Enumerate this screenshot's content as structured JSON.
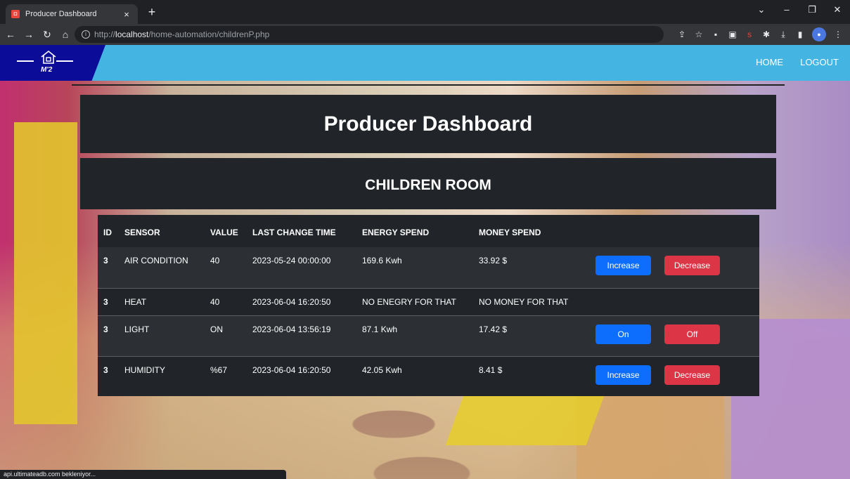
{
  "browser": {
    "tab_title": "Producer Dashboard",
    "tab_close": "×",
    "new_tab": "+",
    "url_prefix": "http://",
    "url_host": "localhost",
    "url_path": "/home-automation/childrenP.php",
    "status_text": "api.ultimateadb.com bekleniyor..."
  },
  "navbar": {
    "logo_text": "M'2",
    "home": "HOME",
    "logout": "LOGOUT",
    "brand_color": "#0b0c98",
    "bar_color": "#44b4e3"
  },
  "header": {
    "title": "Producer Dashboard",
    "room": "CHILDREN ROOM"
  },
  "table": {
    "columns": [
      "ID",
      "SENSOR",
      "VALUE",
      "LAST CHANGE TIME",
      "ENERGY SPEND",
      "MONEY SPEND"
    ],
    "rows": [
      {
        "id": "3",
        "sensor": "AIR CONDITION",
        "value": "40",
        "time": "2023-05-24 00:00:00",
        "energy": "169.6 Kwh",
        "money": "33.92 $",
        "btn1": "Increase",
        "btn2": "Decrease"
      },
      {
        "id": "3",
        "sensor": "HEAT",
        "value": "40",
        "time": "2023-06-04 16:20:50",
        "energy": "NO ENEGRY FOR THAT",
        "money": "NO MONEY FOR THAT"
      },
      {
        "id": "3",
        "sensor": "LIGHT",
        "value": "ON",
        "time": "2023-06-04 13:56:19",
        "energy": "87.1 Kwh",
        "money": "17.42 $",
        "btn1": "On",
        "btn2": "Off"
      },
      {
        "id": "3",
        "sensor": "HUMIDITY",
        "value": "%67",
        "time": "2023-06-04 16:20:50",
        "energy": "42.05 Kwh",
        "money": "8.41 $",
        "btn1": "Increase",
        "btn2": "Decrease"
      }
    ]
  },
  "colors": {
    "primary_button": "#0d6efd",
    "danger_button": "#dc3545",
    "panel": "#212529"
  }
}
